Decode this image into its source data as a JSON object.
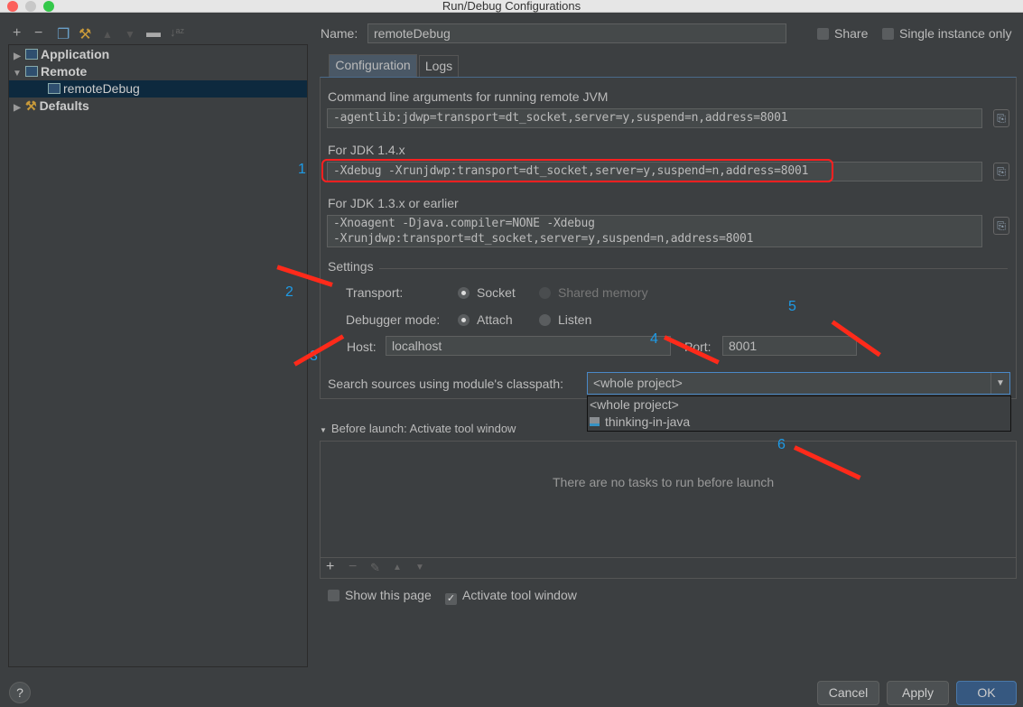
{
  "window": {
    "title": "Run/Debug Configurations"
  },
  "tree": {
    "items": [
      {
        "label": "Application",
        "expanded": false
      },
      {
        "label": "Remote",
        "expanded": true
      },
      {
        "label": "remoteDebug",
        "selected": true
      },
      {
        "label": "Defaults",
        "expanded": false
      }
    ]
  },
  "header": {
    "name_label": "Name:",
    "name_value": "remoteDebug",
    "share": "Share",
    "single_instance": "Single instance only"
  },
  "tabs": [
    "Configuration",
    "Logs"
  ],
  "config": {
    "cmd_label": "Command line arguments for running remote JVM",
    "cmd_value": "-agentlib:jdwp=transport=dt_socket,server=y,suspend=n,address=8001",
    "jdk14_label": "For JDK 1.4.x",
    "jdk14_value": "-Xdebug -Xrunjdwp:transport=dt_socket,server=y,suspend=n,address=8001",
    "jdk13_label": "For JDK 1.3.x or earlier",
    "jdk13_line1": "-Xnoagent -Djava.compiler=NONE -Xdebug",
    "jdk13_line2": "-Xrunjdwp:transport=dt_socket,server=y,suspend=n,address=8001",
    "settings": "Settings",
    "transport_label": "Transport:",
    "socket": "Socket",
    "shared_memory": "Shared memory",
    "mode_label": "Debugger mode:",
    "attach": "Attach",
    "listen": "Listen",
    "host_label": "Host:",
    "host_value": "localhost",
    "port_label": "Port:",
    "port_value": "8001",
    "classpath_label": "Search sources using module's classpath:",
    "classpath_value": "<whole project>",
    "options": [
      "<whole project>",
      "thinking-in-java"
    ]
  },
  "before_launch": {
    "title": "Before launch: Activate tool window",
    "empty": "There are no tasks to run before launch",
    "show_page": "Show this page",
    "activate": "Activate tool window"
  },
  "buttons": {
    "cancel": "Cancel",
    "apply": "Apply",
    "ok": "OK",
    "help": "?"
  },
  "annotations": [
    "1",
    "2",
    "3",
    "4",
    "5",
    "6"
  ]
}
